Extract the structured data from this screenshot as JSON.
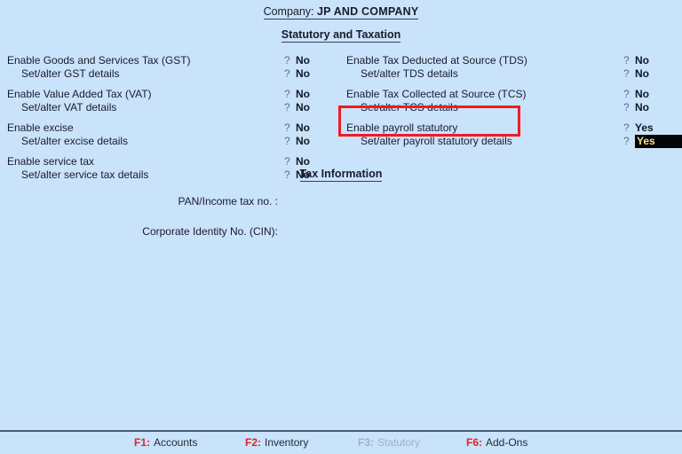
{
  "header": {
    "company_label": "Company:",
    "company_name": "JP AND COMPANY",
    "page_title": "Statutory and Taxation"
  },
  "left_column": [
    {
      "label": "Enable Goods and Services Tax (GST)",
      "marker": "?",
      "value": "No",
      "sub": false
    },
    {
      "label": "Set/alter GST details",
      "marker": "?",
      "value": "No",
      "sub": true
    },
    {
      "label": "Enable Value Added Tax (VAT)",
      "marker": "?",
      "value": "No",
      "sub": false
    },
    {
      "label": "Set/alter VAT details",
      "marker": "?",
      "value": "No",
      "sub": true
    },
    {
      "label": "Enable excise",
      "marker": "?",
      "value": "No",
      "sub": false
    },
    {
      "label": "Set/alter excise details",
      "marker": "?",
      "value": "No",
      "sub": true
    },
    {
      "label": "Enable service tax",
      "marker": "?",
      "value": "No",
      "sub": false
    },
    {
      "label": "Set/alter service tax details",
      "marker": "?",
      "value": "No",
      "sub": true
    }
  ],
  "right_column": [
    {
      "label": "Enable Tax Deducted at Source (TDS)",
      "marker": "?",
      "value": "No",
      "sub": false,
      "selected": false
    },
    {
      "label": "Set/alter TDS details",
      "marker": "?",
      "value": "No",
      "sub": true,
      "selected": false
    },
    {
      "label": "Enable Tax Collected at Source (TCS)",
      "marker": "?",
      "value": "No",
      "sub": false,
      "selected": false
    },
    {
      "label": "Set/alter TCS details",
      "marker": "?",
      "value": "No",
      "sub": true,
      "selected": false
    },
    {
      "label": "Enable payroll statutory",
      "marker": "?",
      "value": "Yes",
      "sub": false,
      "selected": false
    },
    {
      "label": "Set/alter payroll statutory details",
      "marker": "?",
      "value": "Yes",
      "sub": true,
      "selected": true
    }
  ],
  "tax_information": {
    "heading": "Tax Information",
    "fields": [
      {
        "label": "PAN/Income tax no. :",
        "value": ""
      },
      {
        "label": "Corporate Identity No. (CIN):",
        "value": ""
      }
    ]
  },
  "function_bar": {
    "keys": [
      {
        "key": "F1:",
        "label": "Accounts",
        "disabled": false
      },
      {
        "key": "F2:",
        "label": "Inventory",
        "disabled": false
      },
      {
        "key": "F3:",
        "label": "Statutory",
        "disabled": true
      },
      {
        "key": "F6:",
        "label": "Add-Ons",
        "disabled": false
      }
    ]
  },
  "colors": {
    "background": "#c9e3fa",
    "accent_red": "#ec1c24",
    "highlight_border": "#ee1b23",
    "selected_field_bg": "#050505",
    "selected_field_text": "#ffe08a",
    "disabled_text": "#9fb2c8"
  }
}
